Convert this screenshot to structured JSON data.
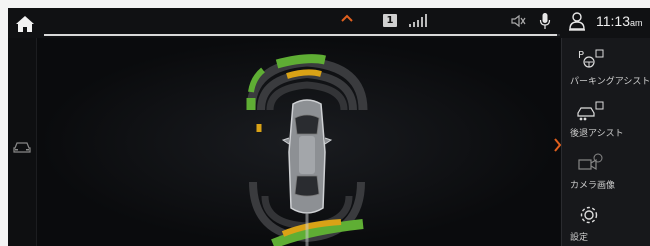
{
  "statusbar": {
    "sim_label": "1",
    "clock_time": "11:13",
    "clock_ampm": "am",
    "progress_fraction": 0.994
  },
  "right_panel": {
    "items": [
      {
        "label": "パーキングアシスト"
      },
      {
        "label": "後退アシスト"
      },
      {
        "label": "カメラ画像"
      },
      {
        "label": "設定"
      }
    ]
  },
  "colors": {
    "accent": "#e0601e",
    "sensor_green": "#5fae34",
    "sensor_yellow": "#d9a216"
  }
}
